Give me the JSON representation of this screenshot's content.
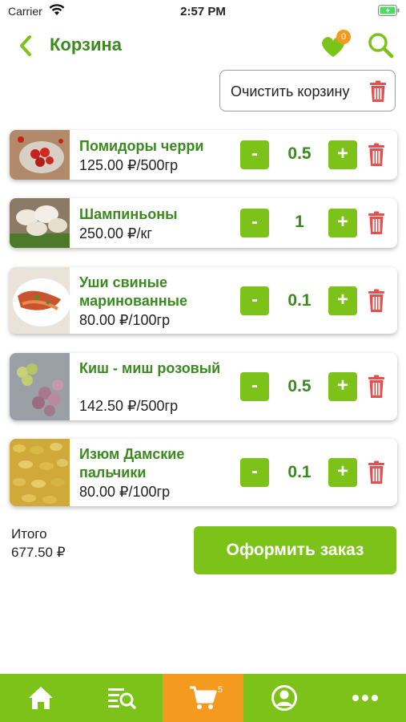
{
  "status_bar": {
    "carrier": "Carrier",
    "time": "2:57 PM"
  },
  "header": {
    "title": "Корзина",
    "favorites_count": "0"
  },
  "clear_cart": {
    "label": "Очистить корзину"
  },
  "items": [
    {
      "name": "Помидоры черри",
      "price": "125.00 ₽/500гр",
      "qty": "0.5",
      "thumb_color": "#9a3d2a"
    },
    {
      "name": "Шампиньоны",
      "price": "250.00 ₽/кг",
      "qty": "1",
      "thumb_color": "#c9b99a"
    },
    {
      "name": "Уши свиные маринованные",
      "price": "80.00 ₽/100гр",
      "qty": "0.1",
      "thumb_color": "#c45a35"
    },
    {
      "name": "Киш - миш розовый",
      "price": "142.50 ₽/500гр",
      "qty": "0.5",
      "thumb_color": "#a88bb0"
    },
    {
      "name": "Изюм Дамские пальчики",
      "price": "80.00 ₽/100гр",
      "qty": "0.1",
      "thumb_color": "#d9b84a"
    }
  ],
  "buttons": {
    "minus": "-",
    "plus": "+"
  },
  "total": {
    "label": "Итого",
    "value": "677.50 ₽"
  },
  "checkout": {
    "label": "Оформить заказ"
  },
  "tabbar": {
    "cart_count": "5"
  },
  "colors": {
    "accent": "#7cc219",
    "title_green": "#3a8a1f",
    "trash_red": "#e2504f",
    "orange": "#f39a1f"
  }
}
